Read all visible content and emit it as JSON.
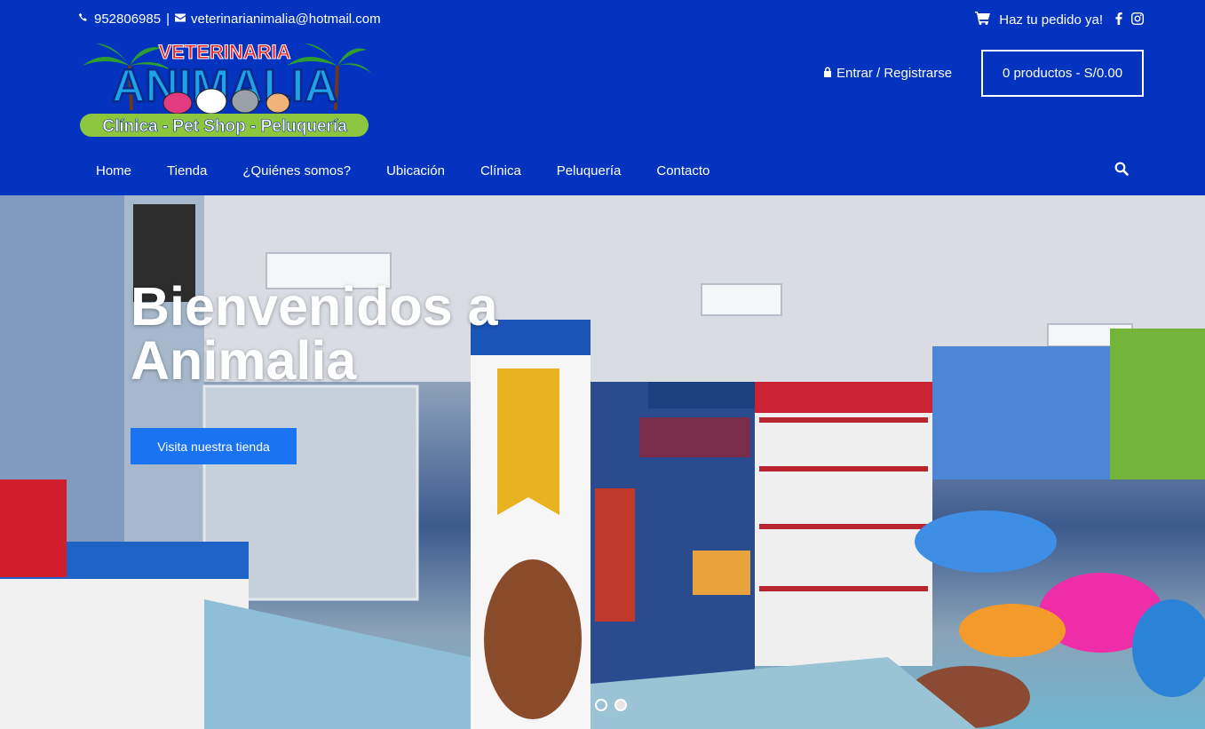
{
  "topbar": {
    "phone": "952806985",
    "separator": "|",
    "email": "veterinarianimalia@hotmail.com",
    "order_text": "Haz tu pedido ya!",
    "icons": [
      "phone-icon",
      "envelope-icon",
      "cart-icon",
      "facebook-icon",
      "instagram-icon"
    ]
  },
  "logo": {
    "line1": "VETERINARIA",
    "line2": "ANIMALIA",
    "tagline": "Clínica - Pet Shop - Peluquería"
  },
  "account": {
    "login_label": "Entrar / Registrarse",
    "cart_label": "0 productos - S/0.00"
  },
  "nav": {
    "items": [
      "Home",
      "Tienda",
      "¿Quiénes somos?",
      "Ubicación",
      "Clínica",
      "Peluquería",
      "Contacto"
    ]
  },
  "hero": {
    "title_line1": "Bienvenidos a",
    "title_line2": "Animalia",
    "button_label": "Visita nuestra tienda",
    "slides": 2,
    "active_slide": 2
  },
  "colors": {
    "header_bg": "#0433c0",
    "button_bg": "#1a73f0",
    "text": "#ffffff"
  }
}
